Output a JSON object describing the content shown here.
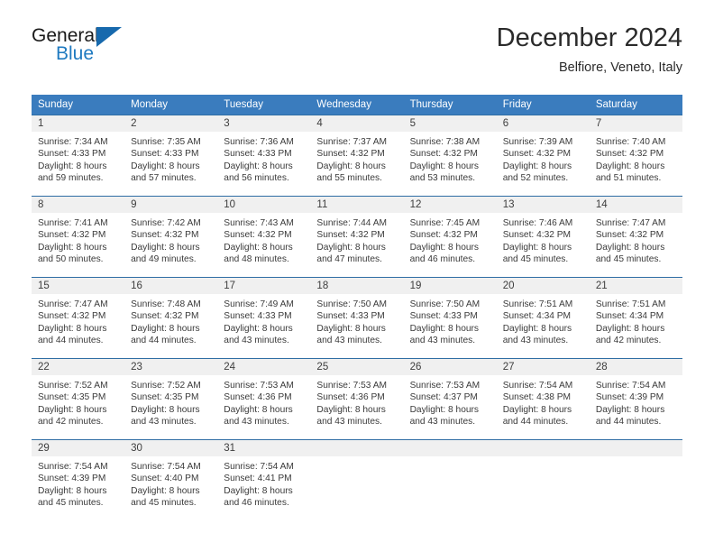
{
  "brand": {
    "name_top": "General",
    "name_bottom": "Blue",
    "triangle_color": "#1769ad",
    "blue_color": "#1f7ac0"
  },
  "header": {
    "title": "December 2024",
    "subtitle": "Belfiore, Veneto, Italy"
  },
  "theme": {
    "header_row_bg": "#3a7cbe",
    "daynum_bg": "#f0f0f0",
    "cell_border": "#2e6da4"
  },
  "weekdays": [
    "Sunday",
    "Monday",
    "Tuesday",
    "Wednesday",
    "Thursday",
    "Friday",
    "Saturday"
  ],
  "weeks": [
    [
      {
        "day": "1",
        "sunrise": "Sunrise: 7:34 AM",
        "sunset": "Sunset: 4:33 PM",
        "daylight1": "Daylight: 8 hours",
        "daylight2": "and 59 minutes."
      },
      {
        "day": "2",
        "sunrise": "Sunrise: 7:35 AM",
        "sunset": "Sunset: 4:33 PM",
        "daylight1": "Daylight: 8 hours",
        "daylight2": "and 57 minutes."
      },
      {
        "day": "3",
        "sunrise": "Sunrise: 7:36 AM",
        "sunset": "Sunset: 4:33 PM",
        "daylight1": "Daylight: 8 hours",
        "daylight2": "and 56 minutes."
      },
      {
        "day": "4",
        "sunrise": "Sunrise: 7:37 AM",
        "sunset": "Sunset: 4:32 PM",
        "daylight1": "Daylight: 8 hours",
        "daylight2": "and 55 minutes."
      },
      {
        "day": "5",
        "sunrise": "Sunrise: 7:38 AM",
        "sunset": "Sunset: 4:32 PM",
        "daylight1": "Daylight: 8 hours",
        "daylight2": "and 53 minutes."
      },
      {
        "day": "6",
        "sunrise": "Sunrise: 7:39 AM",
        "sunset": "Sunset: 4:32 PM",
        "daylight1": "Daylight: 8 hours",
        "daylight2": "and 52 minutes."
      },
      {
        "day": "7",
        "sunrise": "Sunrise: 7:40 AM",
        "sunset": "Sunset: 4:32 PM",
        "daylight1": "Daylight: 8 hours",
        "daylight2": "and 51 minutes."
      }
    ],
    [
      {
        "day": "8",
        "sunrise": "Sunrise: 7:41 AM",
        "sunset": "Sunset: 4:32 PM",
        "daylight1": "Daylight: 8 hours",
        "daylight2": "and 50 minutes."
      },
      {
        "day": "9",
        "sunrise": "Sunrise: 7:42 AM",
        "sunset": "Sunset: 4:32 PM",
        "daylight1": "Daylight: 8 hours",
        "daylight2": "and 49 minutes."
      },
      {
        "day": "10",
        "sunrise": "Sunrise: 7:43 AM",
        "sunset": "Sunset: 4:32 PM",
        "daylight1": "Daylight: 8 hours",
        "daylight2": "and 48 minutes."
      },
      {
        "day": "11",
        "sunrise": "Sunrise: 7:44 AM",
        "sunset": "Sunset: 4:32 PM",
        "daylight1": "Daylight: 8 hours",
        "daylight2": "and 47 minutes."
      },
      {
        "day": "12",
        "sunrise": "Sunrise: 7:45 AM",
        "sunset": "Sunset: 4:32 PM",
        "daylight1": "Daylight: 8 hours",
        "daylight2": "and 46 minutes."
      },
      {
        "day": "13",
        "sunrise": "Sunrise: 7:46 AM",
        "sunset": "Sunset: 4:32 PM",
        "daylight1": "Daylight: 8 hours",
        "daylight2": "and 45 minutes."
      },
      {
        "day": "14",
        "sunrise": "Sunrise: 7:47 AM",
        "sunset": "Sunset: 4:32 PM",
        "daylight1": "Daylight: 8 hours",
        "daylight2": "and 45 minutes."
      }
    ],
    [
      {
        "day": "15",
        "sunrise": "Sunrise: 7:47 AM",
        "sunset": "Sunset: 4:32 PM",
        "daylight1": "Daylight: 8 hours",
        "daylight2": "and 44 minutes."
      },
      {
        "day": "16",
        "sunrise": "Sunrise: 7:48 AM",
        "sunset": "Sunset: 4:32 PM",
        "daylight1": "Daylight: 8 hours",
        "daylight2": "and 44 minutes."
      },
      {
        "day": "17",
        "sunrise": "Sunrise: 7:49 AM",
        "sunset": "Sunset: 4:33 PM",
        "daylight1": "Daylight: 8 hours",
        "daylight2": "and 43 minutes."
      },
      {
        "day": "18",
        "sunrise": "Sunrise: 7:50 AM",
        "sunset": "Sunset: 4:33 PM",
        "daylight1": "Daylight: 8 hours",
        "daylight2": "and 43 minutes."
      },
      {
        "day": "19",
        "sunrise": "Sunrise: 7:50 AM",
        "sunset": "Sunset: 4:33 PM",
        "daylight1": "Daylight: 8 hours",
        "daylight2": "and 43 minutes."
      },
      {
        "day": "20",
        "sunrise": "Sunrise: 7:51 AM",
        "sunset": "Sunset: 4:34 PM",
        "daylight1": "Daylight: 8 hours",
        "daylight2": "and 43 minutes."
      },
      {
        "day": "21",
        "sunrise": "Sunrise: 7:51 AM",
        "sunset": "Sunset: 4:34 PM",
        "daylight1": "Daylight: 8 hours",
        "daylight2": "and 42 minutes."
      }
    ],
    [
      {
        "day": "22",
        "sunrise": "Sunrise: 7:52 AM",
        "sunset": "Sunset: 4:35 PM",
        "daylight1": "Daylight: 8 hours",
        "daylight2": "and 42 minutes."
      },
      {
        "day": "23",
        "sunrise": "Sunrise: 7:52 AM",
        "sunset": "Sunset: 4:35 PM",
        "daylight1": "Daylight: 8 hours",
        "daylight2": "and 43 minutes."
      },
      {
        "day": "24",
        "sunrise": "Sunrise: 7:53 AM",
        "sunset": "Sunset: 4:36 PM",
        "daylight1": "Daylight: 8 hours",
        "daylight2": "and 43 minutes."
      },
      {
        "day": "25",
        "sunrise": "Sunrise: 7:53 AM",
        "sunset": "Sunset: 4:36 PM",
        "daylight1": "Daylight: 8 hours",
        "daylight2": "and 43 minutes."
      },
      {
        "day": "26",
        "sunrise": "Sunrise: 7:53 AM",
        "sunset": "Sunset: 4:37 PM",
        "daylight1": "Daylight: 8 hours",
        "daylight2": "and 43 minutes."
      },
      {
        "day": "27",
        "sunrise": "Sunrise: 7:54 AM",
        "sunset": "Sunset: 4:38 PM",
        "daylight1": "Daylight: 8 hours",
        "daylight2": "and 44 minutes."
      },
      {
        "day": "28",
        "sunrise": "Sunrise: 7:54 AM",
        "sunset": "Sunset: 4:39 PM",
        "daylight1": "Daylight: 8 hours",
        "daylight2": "and 44 minutes."
      }
    ],
    [
      {
        "day": "29",
        "sunrise": "Sunrise: 7:54 AM",
        "sunset": "Sunset: 4:39 PM",
        "daylight1": "Daylight: 8 hours",
        "daylight2": "and 45 minutes."
      },
      {
        "day": "30",
        "sunrise": "Sunrise: 7:54 AM",
        "sunset": "Sunset: 4:40 PM",
        "daylight1": "Daylight: 8 hours",
        "daylight2": "and 45 minutes."
      },
      {
        "day": "31",
        "sunrise": "Sunrise: 7:54 AM",
        "sunset": "Sunset: 4:41 PM",
        "daylight1": "Daylight: 8 hours",
        "daylight2": "and 46 minutes."
      },
      {
        "day": "",
        "sunrise": "",
        "sunset": "",
        "daylight1": "",
        "daylight2": ""
      },
      {
        "day": "",
        "sunrise": "",
        "sunset": "",
        "daylight1": "",
        "daylight2": ""
      },
      {
        "day": "",
        "sunrise": "",
        "sunset": "",
        "daylight1": "",
        "daylight2": ""
      },
      {
        "day": "",
        "sunrise": "",
        "sunset": "",
        "daylight1": "",
        "daylight2": ""
      }
    ]
  ]
}
